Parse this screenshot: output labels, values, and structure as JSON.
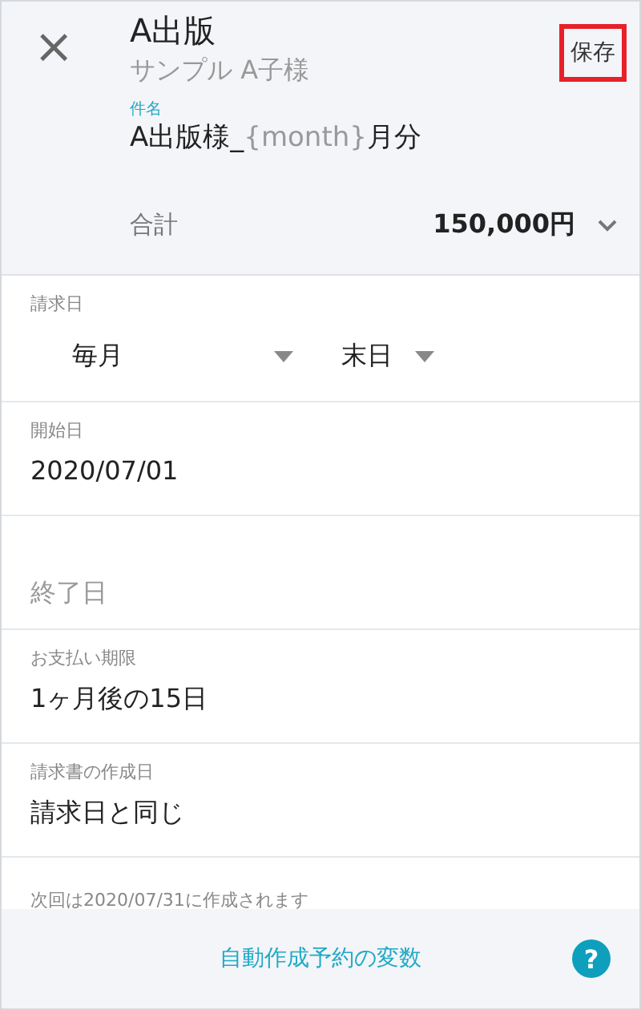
{
  "header": {
    "close_icon": "×",
    "title": "A出版",
    "client": "サンプル A子様",
    "save_button": "保存",
    "save_highlighted": true,
    "subject": {
      "label": "件名",
      "parts": [
        {
          "kind": "text",
          "text": "A出版様_"
        },
        {
          "kind": "variable",
          "text": "{month}"
        },
        {
          "kind": "text",
          "text": "月分"
        }
      ]
    },
    "total": {
      "label": "合計",
      "value": "150,000円",
      "expanded": false
    }
  },
  "billing_date": {
    "label": "請求日",
    "selects": [
      "毎月",
      "末日"
    ]
  },
  "fields": [
    {
      "label": "開始日",
      "value": "2020/07/01"
    },
    {
      "placeholder": "終了日"
    },
    {
      "label": "お支払い期限",
      "value": "1ヶ月後の15日"
    },
    {
      "label": "請求書の作成日",
      "value": "請求日と同じ"
    }
  ],
  "note": "次回は2020/07/31に作成されます",
  "footer": {
    "link": "自動作成予約の変数",
    "help_icon": "?"
  }
}
